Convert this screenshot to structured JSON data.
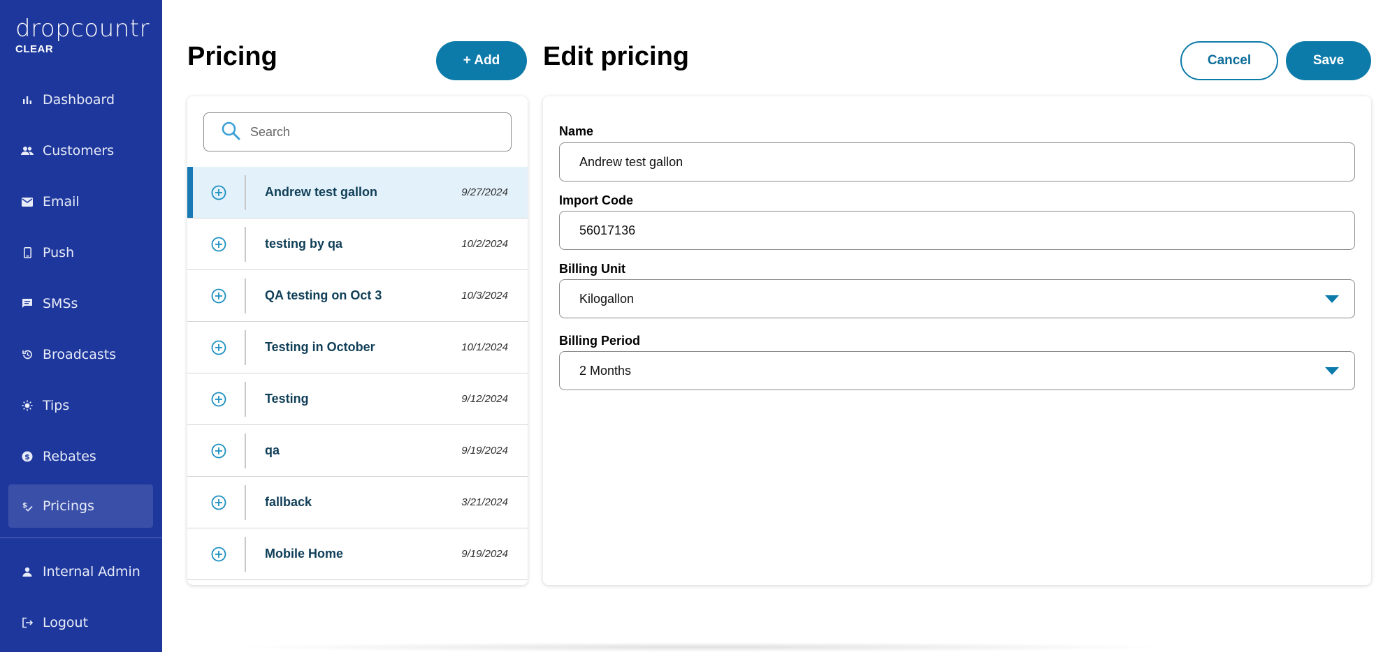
{
  "brand": {
    "name": "dropcountr",
    "sub": "CLEAR"
  },
  "sidebar": {
    "items": [
      {
        "label": "Dashboard",
        "icon": "bar-chart-icon"
      },
      {
        "label": "Customers",
        "icon": "people-icon"
      },
      {
        "label": "Email",
        "icon": "mail-icon"
      },
      {
        "label": "Push",
        "icon": "phone-icon"
      },
      {
        "label": "SMSs",
        "icon": "message-icon"
      },
      {
        "label": "Broadcasts",
        "icon": "history-icon"
      },
      {
        "label": "Tips",
        "icon": "sun-icon"
      },
      {
        "label": "Rebates",
        "icon": "dollar-icon"
      },
      {
        "label": "Pricings",
        "icon": "pricing-icon",
        "active": true
      }
    ],
    "footer": [
      {
        "label": "Internal Admin",
        "icon": "person-icon"
      },
      {
        "label": "Logout",
        "icon": "logout-icon"
      }
    ]
  },
  "pricing": {
    "title": "Pricing",
    "add_label": "+ Add",
    "search_placeholder": "Search",
    "rows": [
      {
        "name": "Andrew test gallon",
        "date": "9/27/2024",
        "selected": true
      },
      {
        "name": "testing by qa",
        "date": "10/2/2024"
      },
      {
        "name": "QA testing on Oct 3",
        "date": "10/3/2024"
      },
      {
        "name": "Testing in October",
        "date": "10/1/2024"
      },
      {
        "name": "Testing",
        "date": "9/12/2024"
      },
      {
        "name": "qa",
        "date": "9/19/2024"
      },
      {
        "name": "fallback",
        "date": "3/21/2024"
      },
      {
        "name": "Mobile Home",
        "date": "9/19/2024"
      }
    ]
  },
  "edit": {
    "title": "Edit pricing",
    "cancel_label": "Cancel",
    "save_label": "Save",
    "name_label": "Name",
    "name_value": "Andrew test gallon",
    "import_code_label": "Import Code",
    "import_code_value": "56017136",
    "billing_unit_label": "Billing Unit",
    "billing_unit_value": "Kilogallon",
    "billing_period_label": "Billing Period",
    "billing_period_value": "2 Months"
  },
  "colors": {
    "sidebar_bg": "#1e379c",
    "accent": "#0d7ba9",
    "selected_row_bg": "#e3f1fb"
  }
}
